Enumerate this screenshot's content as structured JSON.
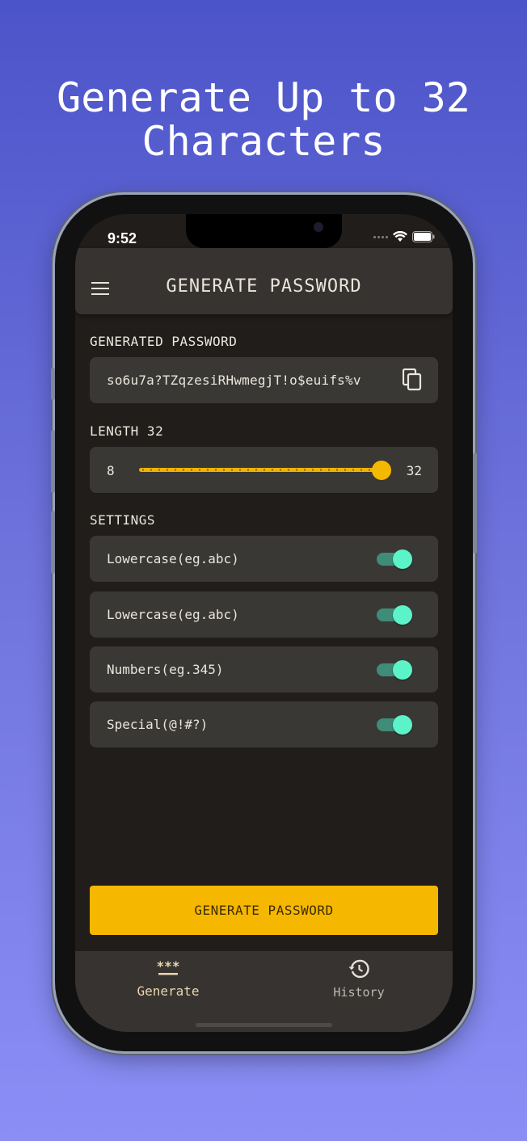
{
  "headline": {
    "line1": "Generate Up to 32",
    "line2": "Characters"
  },
  "status_bar": {
    "time": "9:52"
  },
  "appbar": {
    "title": "GENERATE PASSWORD",
    "menu_icon": "hamburger-menu-icon"
  },
  "generated": {
    "label": "GENERATED PASSWORD",
    "password": "so6u7a?TZqzesiRHwmegjT!o$euifs%v",
    "copy_icon": "copy-icon"
  },
  "length": {
    "label": "LENGTH 32",
    "min": "8",
    "max": "32",
    "value": 32,
    "range": [
      8,
      32
    ]
  },
  "settings": {
    "label": "SETTINGS",
    "items": [
      {
        "label": "Lowercase(eg.abc)",
        "enabled": true
      },
      {
        "label": "Lowercase(eg.abc)",
        "enabled": true
      },
      {
        "label": "Numbers(eg.345)",
        "enabled": true
      },
      {
        "label": "Special(@!#?)",
        "enabled": true
      }
    ]
  },
  "generate_button": {
    "label": "GENERATE PASSWORD"
  },
  "bottom_nav": {
    "items": [
      {
        "label": "Generate",
        "icon": "password-asterisks-icon",
        "active": true
      },
      {
        "label": "History",
        "icon": "history-icon",
        "active": false
      }
    ]
  },
  "colors": {
    "accent": "#f6b700",
    "toggle_on": "#5cf3c9",
    "background": "#201d1a",
    "surface": "#3a3835"
  }
}
